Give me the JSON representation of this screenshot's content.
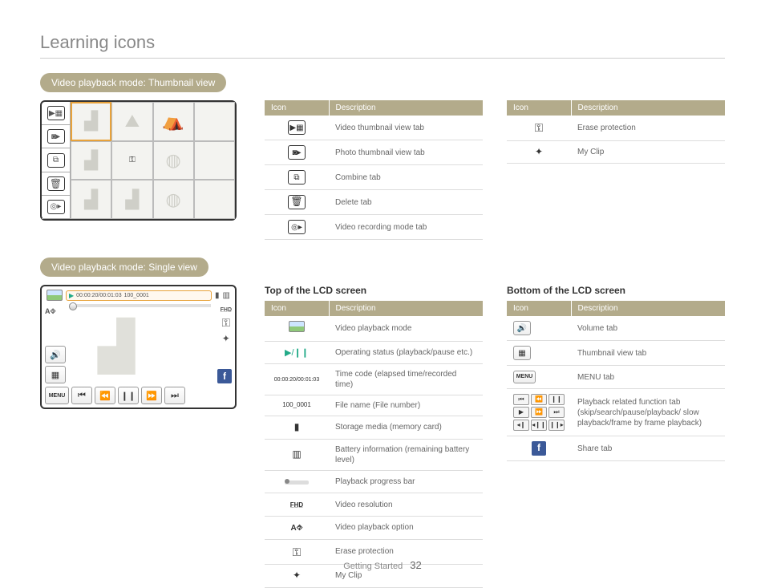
{
  "title": "Learning icons",
  "footer": {
    "section": "Getting Started",
    "page": "32"
  },
  "pill1": "Video playback mode: Thumbnail view",
  "pill2": "Video playback mode: Single view",
  "table_headers": {
    "icon": "Icon",
    "desc": "Description"
  },
  "subheads": {
    "top": "Top of the LCD screen",
    "bottom": "Bottom of the LCD screen"
  },
  "thumb_tabs": [
    {
      "desc": "Video thumbnail view tab"
    },
    {
      "desc": "Photo thumbnail view tab"
    },
    {
      "desc": "Combine tab"
    },
    {
      "desc": "Delete tab"
    },
    {
      "desc": "Video recording mode tab"
    }
  ],
  "thumb_right": [
    {
      "desc": "Erase protection"
    },
    {
      "desc": "My Clip"
    }
  ],
  "single": {
    "timecode": "00:00:20/00:01:03",
    "filename": "100_0001"
  },
  "top_rows": [
    {
      "icon": "photo",
      "desc": "Video playback mode"
    },
    {
      "icon": "playpause",
      "label": "▶/❙❙",
      "desc": "Operating status (playback/pause etc.)"
    },
    {
      "icon": "text",
      "label": "00:00:20/00:01:03",
      "desc": "Time code (elapsed time/recorded time)"
    },
    {
      "icon": "text",
      "label": "100_0001",
      "desc": "File name (File number)"
    },
    {
      "icon": "card",
      "desc": "Storage media (memory card)"
    },
    {
      "icon": "battery",
      "desc": "Battery information (remaining battery level)"
    },
    {
      "icon": "pbar",
      "desc": "Playback progress bar"
    },
    {
      "icon": "hd",
      "desc": "Video resolution"
    },
    {
      "icon": "all",
      "label": "A⯑",
      "desc": "Video playback option"
    },
    {
      "icon": "key",
      "desc": "Erase protection"
    },
    {
      "icon": "wand",
      "desc": "My Clip"
    }
  ],
  "bottom_rows": [
    {
      "icon": "vol",
      "desc": "Volume tab"
    },
    {
      "icon": "thumb",
      "desc": "Thumbnail view tab"
    },
    {
      "icon": "menu",
      "label": "MENU",
      "desc": "MENU tab"
    },
    {
      "icon": "btngrid",
      "desc": "Playback related function tab (skip/search/pause/playback/ slow playback/frame by frame playback)"
    },
    {
      "icon": "fb",
      "desc": "Share tab"
    }
  ]
}
